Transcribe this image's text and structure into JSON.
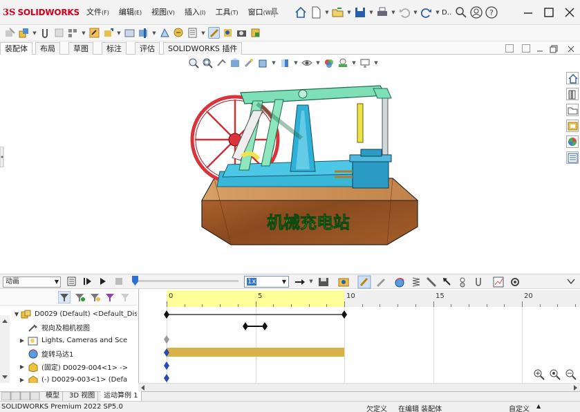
{
  "app": {
    "brand_prefix": "3S",
    "brand": "SOLIDWORKS"
  },
  "menu": [
    {
      "label": "文件",
      "key": "(F)"
    },
    {
      "label": "编辑",
      "key": "(E)"
    },
    {
      "label": "视图",
      "key": "(V)"
    },
    {
      "label": "插入",
      "key": "(I)"
    },
    {
      "label": "工具",
      "key": "(T)"
    },
    {
      "label": "窗口",
      "key": "(W)"
    }
  ],
  "quickbar": {
    "doc_label": "D.."
  },
  "tabs": [
    "装配体",
    "布局",
    "草图",
    "标注",
    "评估",
    "SOLIDWORKS 插件"
  ],
  "model": {
    "engraving": "机械充电站"
  },
  "motion": {
    "study_type": "动画",
    "speed": "1x",
    "ruler_labels": [
      "0",
      "5",
      "10",
      "15",
      "20"
    ],
    "tree": [
      {
        "label": "D0029 (Default) <Default_Dis",
        "icon": "assembly-icon"
      },
      {
        "label": "视向及相机视图",
        "icon": "camera-icon"
      },
      {
        "label": "Lights, Cameras and Sce",
        "icon": "lights-folder-icon"
      },
      {
        "label": "旋转马达1",
        "icon": "rotary-motor-icon"
      },
      {
        "label": "(固定) D0029-004<1> ->",
        "icon": "part-icon"
      },
      {
        "label": "(-) D0029-003<1> (Defa",
        "icon": "part-icon"
      }
    ]
  },
  "bottom_tabs": [
    "模型",
    "3D 视图",
    "运动算例 1"
  ],
  "status": {
    "product": "SOLIDWORKS Premium 2022 SP5.0",
    "defined": "欠定义",
    "editing": "在编辑 装配体",
    "custom": "自定义"
  }
}
